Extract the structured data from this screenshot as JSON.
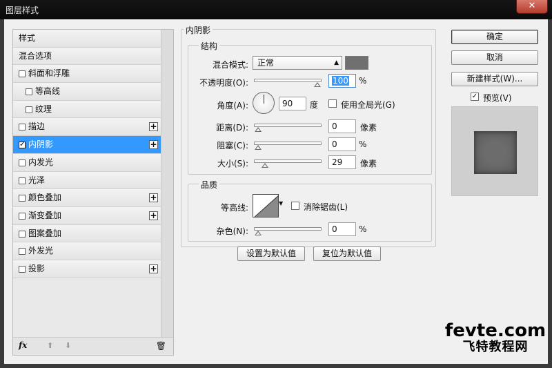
{
  "window": {
    "title": "图层样式",
    "close": "✕"
  },
  "left_panel": {
    "items": [
      {
        "label": "样式",
        "checkbox": false,
        "checked": false,
        "plus": false,
        "selected": false,
        "level": 0
      },
      {
        "label": "混合选项",
        "checkbox": false,
        "checked": false,
        "plus": false,
        "selected": false,
        "level": 0
      },
      {
        "label": "斜面和浮雕",
        "checkbox": true,
        "checked": false,
        "plus": false,
        "selected": false,
        "level": 1
      },
      {
        "label": "等高线",
        "checkbox": true,
        "checked": false,
        "plus": false,
        "selected": false,
        "level": 2
      },
      {
        "label": "纹理",
        "checkbox": true,
        "checked": false,
        "plus": false,
        "selected": false,
        "level": 2
      },
      {
        "label": "描边",
        "checkbox": true,
        "checked": false,
        "plus": true,
        "selected": false,
        "level": 1
      },
      {
        "label": "内阴影",
        "checkbox": true,
        "checked": true,
        "plus": true,
        "selected": true,
        "level": 1
      },
      {
        "label": "内发光",
        "checkbox": true,
        "checked": false,
        "plus": false,
        "selected": false,
        "level": 1
      },
      {
        "label": "光泽",
        "checkbox": true,
        "checked": false,
        "plus": false,
        "selected": false,
        "level": 1
      },
      {
        "label": "颜色叠加",
        "checkbox": true,
        "checked": false,
        "plus": true,
        "selected": false,
        "level": 1
      },
      {
        "label": "渐变叠加",
        "checkbox": true,
        "checked": false,
        "plus": true,
        "selected": false,
        "level": 1
      },
      {
        "label": "图案叠加",
        "checkbox": true,
        "checked": false,
        "plus": false,
        "selected": false,
        "level": 1
      },
      {
        "label": "外发光",
        "checkbox": true,
        "checked": false,
        "plus": false,
        "selected": false,
        "level": 1
      },
      {
        "label": "投影",
        "checkbox": true,
        "checked": false,
        "plus": true,
        "selected": false,
        "level": 1
      }
    ],
    "footer": {
      "fx": "fx",
      "up": "⬆",
      "down": "⬇",
      "trash": "🗑"
    }
  },
  "inner_shadow": {
    "section_title": "内阴影",
    "structure": {
      "title": "结构",
      "blend_mode_label": "混合模式:",
      "blend_mode_value": "正常",
      "shadow_color": "#707070",
      "opacity_label": "不透明度(O):",
      "opacity_value": "100",
      "opacity_unit": "%",
      "opacity_level": 1.0,
      "angle_label": "角度(A):",
      "angle_value": "90",
      "angle_unit": "度",
      "global_light_label": "使用全局光(G)",
      "global_light_checked": false,
      "distance_label": "距离(D):",
      "distance_value": "0",
      "distance_unit": "像素",
      "distance_level": 0.0,
      "choke_label": "阻塞(C):",
      "choke_value": "0",
      "choke_unit": "%",
      "choke_level": 0.0,
      "size_label": "大小(S):",
      "size_value": "29",
      "size_unit": "像素",
      "size_level": 0.12
    },
    "quality": {
      "title": "品质",
      "contour_label": "等高线:",
      "antialias_label": "消除锯齿(L)",
      "antialias_checked": false,
      "noise_label": "杂色(N):",
      "noise_value": "0",
      "noise_unit": "%",
      "noise_level": 0.0
    },
    "make_default": "设置为默认值",
    "reset_default": "复位为默认值"
  },
  "right_panel": {
    "ok": "确定",
    "cancel": "取消",
    "new_style": "新建样式(W)...",
    "preview_label": "预览(V)",
    "preview_checked": true
  },
  "watermark": {
    "line1": "fevte.com",
    "line2": "飞特教程网"
  }
}
